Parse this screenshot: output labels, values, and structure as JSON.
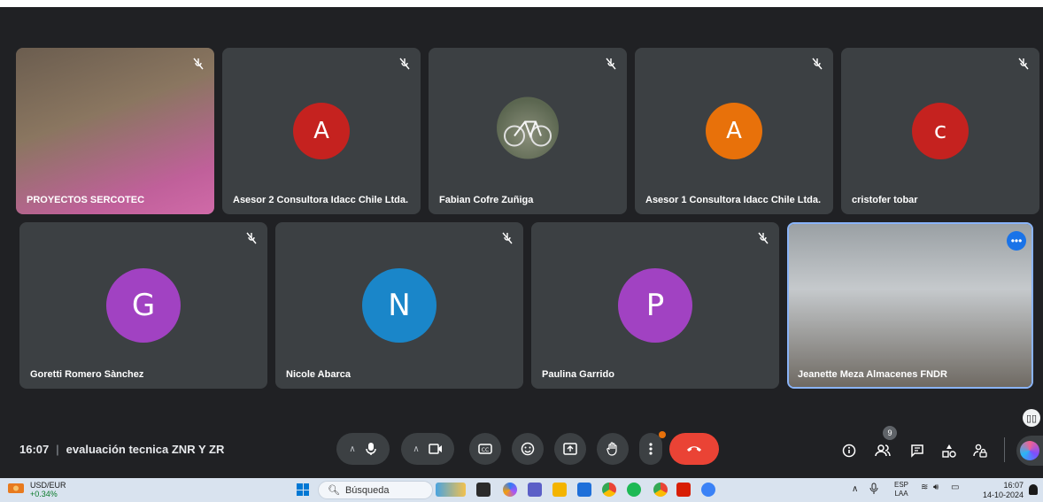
{
  "tiles_row1": [
    {
      "name": "PROYECTOS SERCOTEC",
      "type": "video"
    },
    {
      "name": "Asesor 2 Consultora Idacc Chile Ltda.",
      "initial": "A",
      "color": "#c5221f"
    },
    {
      "name": "Fabian Cofre Zuñiga",
      "type": "photo"
    },
    {
      "name": "Asesor 1 Consultora Idacc Chile Ltda.",
      "initial": "A",
      "color": "#e8710a"
    },
    {
      "name": "cristofer tobar",
      "initial": "c",
      "color": "#c5221f"
    }
  ],
  "tiles_row2": [
    {
      "name": "Goretti Romero Sànchez",
      "initial": "G",
      "color": "#a142c2"
    },
    {
      "name": "Nicole Abarca",
      "initial": "N",
      "color": "#1a86c9"
    },
    {
      "name": "Paulina Garrido",
      "initial": "P",
      "color": "#a142c2"
    },
    {
      "name": "Jeanette Meza Almacenes FNDR",
      "type": "video"
    }
  ],
  "meeting": {
    "time": "16:07",
    "separator": "|",
    "title": "evaluación tecnica ZNR Y ZR"
  },
  "controls": {
    "mic_icon": "microphone-icon",
    "camera_icon": "camera-icon",
    "captions_icon": "captions-icon",
    "emoji_icon": "emoji-icon",
    "present_icon": "present-icon",
    "hand_icon": "raise-hand-icon",
    "more_icon": "more-vert-icon",
    "end_icon": "end-call-icon"
  },
  "right_controls": {
    "people_count": "9"
  },
  "taskbar": {
    "stock_symbol": "USD/EUR",
    "stock_change": "+0.34%",
    "search_placeholder": "Búsqueda",
    "lang_top": "ESP",
    "lang_bottom": "LAA",
    "time": "16:07",
    "date": "14-10-2024"
  },
  "colors": {
    "accent": "#8ab4f8",
    "end_call": "#ea4335",
    "tile_bg": "#3c4043",
    "page_bg": "#202124"
  }
}
